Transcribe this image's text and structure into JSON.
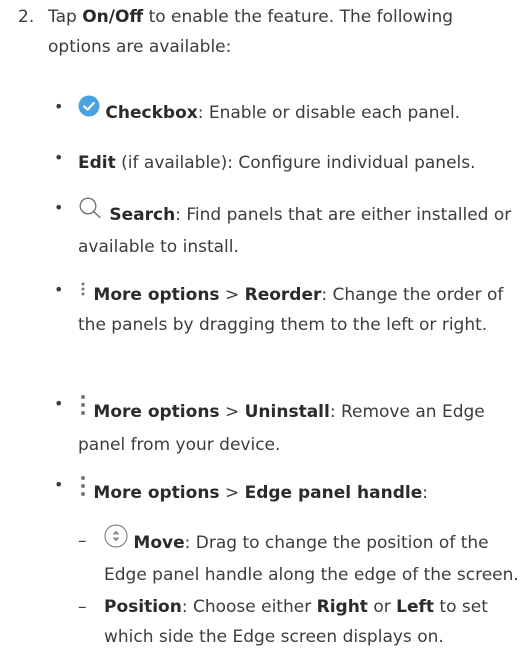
{
  "step": {
    "number": "2.",
    "text_a": "Tap ",
    "on_off": "On/Off",
    "text_b": " to enable the feature. The following options are available:"
  },
  "bullets": [
    {
      "symbol": "•",
      "icon": "checkbox-check-icon",
      "label": "Checkbox",
      "text": ": Enable or disable each panel."
    },
    {
      "symbol": "•",
      "label": "Edit",
      "text": " (if available): Configure individual panels."
    },
    {
      "symbol": "•",
      "icon": "search-icon",
      "label": "Search",
      "text": ": Find panels that are either installed or available to install."
    },
    {
      "symbol": "•",
      "icon": "more-options-icon",
      "label": "More options",
      "sep": " > ",
      "label2": "Reorder",
      "text": ": Change the order of the panels by dragging them to the left or right."
    },
    {
      "symbol": "•",
      "icon": "more-options-icon",
      "label": "More options",
      "sep": " > ",
      "label2": "Uninstall",
      "text": ": Remove an Edge panel from your device."
    },
    {
      "symbol": "•",
      "icon": "more-options-icon",
      "label": "More options",
      "sep": " > ",
      "label2": "Edge panel handle",
      "text": ":"
    }
  ],
  "subbullets": [
    {
      "symbol": "–",
      "icon": "move-icon",
      "label": "Move",
      "text": ": Drag to change the position of the Edge panel handle along the edge of the screen."
    },
    {
      "symbol": "–",
      "label": "Position",
      "text_a": ": Choose either ",
      "right": "Right",
      "text_b": " or ",
      "left": "Left",
      "text_c": " to set which side the Edge screen displays on."
    }
  ],
  "colors": {
    "accent": "#4aa3e0",
    "text": "#3c3c3c"
  }
}
